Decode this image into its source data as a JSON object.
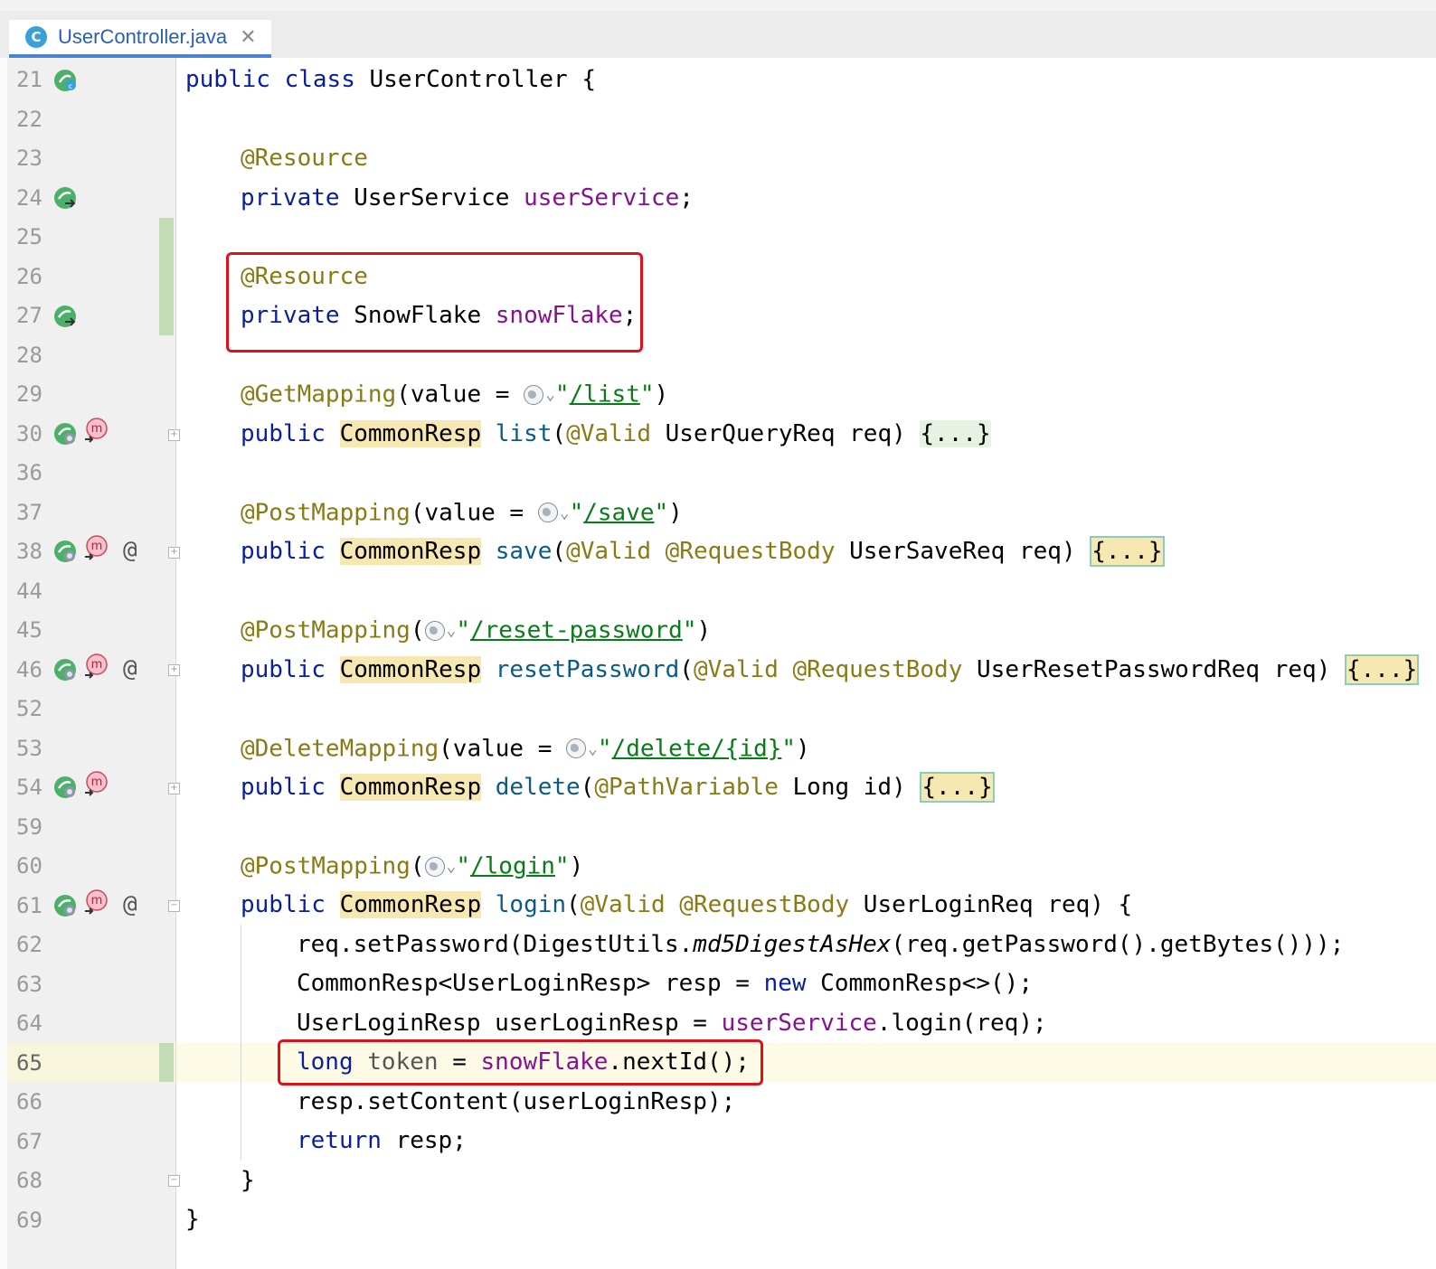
{
  "tab": {
    "title": "UserController.java",
    "icon_letter": "C"
  },
  "line_numbers": [
    "21",
    "22",
    "23",
    "24",
    "25",
    "26",
    "27",
    "28",
    "29",
    "30",
    "36",
    "37",
    "38",
    "44",
    "45",
    "46",
    "52",
    "53",
    "54",
    "59",
    "60",
    "61",
    "62",
    "63",
    "64",
    "65",
    "66",
    "67",
    "68",
    "69"
  ],
  "gutter_icons": {
    "at_symbol": "@",
    "method_badge": "m"
  },
  "code": {
    "l21": {
      "kw1": "public",
      "kw2": "class",
      "name": "UserController",
      "brace": "{"
    },
    "l23": {
      "ann": "@Resource"
    },
    "l24": {
      "kw": "private",
      "type": "UserService",
      "field": "userService",
      "end": ";"
    },
    "l26": {
      "ann": "@Resource"
    },
    "l27": {
      "kw": "private",
      "type": "SnowFlake",
      "field": "snowFlake",
      "end": ";"
    },
    "l29": {
      "ann": "@GetMapping",
      "pre": "(value = ",
      "q1": "\"",
      "url": "/list",
      "q2": "\"",
      "post": ")"
    },
    "l30": {
      "kw": "public",
      "type": "CommonResp",
      "method": "list",
      "p1": "(",
      "ann": "@Valid",
      "rest": " UserQueryReq req) ",
      "fold": "{...}"
    },
    "l37": {
      "ann": "@PostMapping",
      "pre": "(value = ",
      "q1": "\"",
      "url": "/save",
      "q2": "\"",
      "post": ")"
    },
    "l38": {
      "kw": "public",
      "type": "CommonResp",
      "method": "save",
      "p1": "(",
      "ann1": "@Valid",
      "ann2": "@RequestBody",
      "rest": " UserSaveReq req) ",
      "fold": "{...}"
    },
    "l45": {
      "ann": "@PostMapping",
      "pre": "(",
      "q1": "\"",
      "url": "/reset-password",
      "q2": "\"",
      "post": ")"
    },
    "l46": {
      "kw": "public",
      "type": "CommonResp",
      "method": "resetPassword",
      "p1": "(",
      "ann1": "@Valid",
      "ann2": "@RequestBody",
      "rest": " UserResetPasswordReq req) ",
      "fold": "{...}"
    },
    "l53": {
      "ann": "@DeleteMapping",
      "pre": "(value = ",
      "q1": "\"",
      "url": "/delete/{id}",
      "q2": "\"",
      "post": ")"
    },
    "l54": {
      "kw": "public",
      "type": "CommonResp",
      "method": "delete",
      "p1": "(",
      "ann": "@PathVariable",
      "rest": " Long id) ",
      "fold": "{...}"
    },
    "l60": {
      "ann": "@PostMapping",
      "pre": "(",
      "q1": "\"",
      "url": "/login",
      "q2": "\"",
      "post": ")"
    },
    "l61": {
      "kw": "public",
      "type": "CommonResp",
      "method": "login",
      "p1": "(",
      "ann1": "@Valid",
      "ann2": "@RequestBody",
      "rest": " UserLoginReq req) {"
    },
    "l62": {
      "a": "req.setPassword(DigestUtils.",
      "b": "md5DigestAsHex",
      "c": "(req.getPassword().getBytes()));"
    },
    "l63": {
      "a": "CommonResp<UserLoginResp> resp = ",
      "kw": "new",
      "b": " CommonResp<>();"
    },
    "l64": {
      "a": "UserLoginResp userLoginResp = ",
      "field": "userService",
      "b": ".login(req);"
    },
    "l65": {
      "kw": "long",
      "var": "token",
      "a": " = ",
      "field": "snowFlake",
      "b": ".nextId();"
    },
    "l66": {
      "a": "resp.setContent(userLoginResp);"
    },
    "l67": {
      "kw": "return",
      "a": " resp;"
    },
    "l68": {
      "a": "}"
    },
    "l69": {
      "a": "}"
    }
  },
  "colors": {
    "keyword": "#0a1ea0",
    "annotation": "#8a7a14",
    "field": "#871094",
    "string": "#067d17",
    "highlight_box": "#e0101a",
    "current_line": "#fdfbe6"
  }
}
